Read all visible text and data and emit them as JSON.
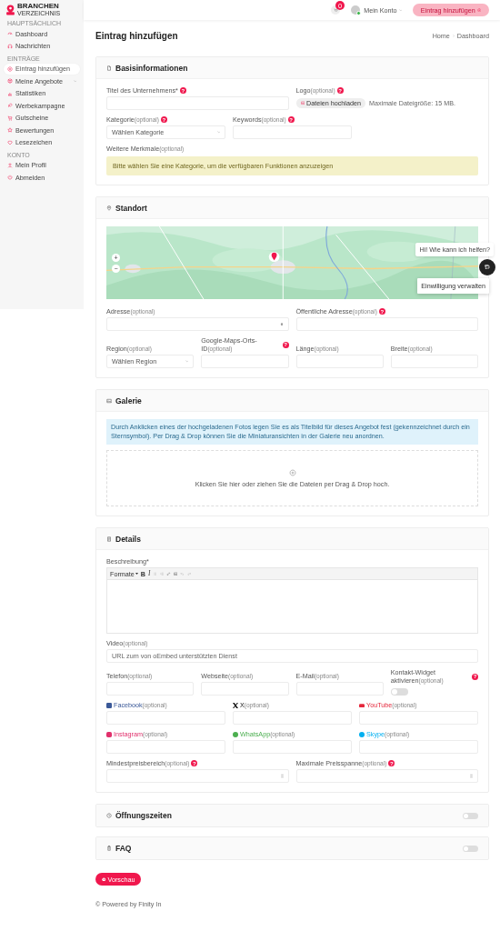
{
  "sidebar": {
    "logo": {
      "line1": "BRANCHEN",
      "line2": "VERZEICHNIS"
    },
    "sections": [
      {
        "heading": "HAUPTSÄCHLICH",
        "items": [
          {
            "label": "Dashboard",
            "selected": false,
            "expandable": false
          },
          {
            "label": "Nachrichten",
            "selected": false,
            "expandable": false
          }
        ]
      },
      {
        "heading": "EINTRÄGE",
        "items": [
          {
            "label": "Eintrag hinzufügen",
            "selected": true,
            "expandable": false
          },
          {
            "label": "Meine Angebote",
            "selected": false,
            "expandable": true
          },
          {
            "label": "Statistiken",
            "selected": false,
            "expandable": false
          },
          {
            "label": "Werbekampagne",
            "selected": false,
            "expandable": false
          },
          {
            "label": "Gutscheine",
            "selected": false,
            "expandable": false
          },
          {
            "label": "Bewertungen",
            "selected": false,
            "expandable": false
          },
          {
            "label": "Lesezeichen",
            "selected": false,
            "expandable": false
          }
        ]
      },
      {
        "heading": "KONTO",
        "items": [
          {
            "label": "Mein Profil",
            "selected": false,
            "expandable": false
          },
          {
            "label": "Abmelden",
            "selected": false,
            "expandable": false
          }
        ]
      }
    ]
  },
  "header": {
    "cart_count": "0",
    "account": "Mein Konto",
    "add_button": "Eintrag hinzufügen"
  },
  "page": {
    "title": "Eintrag hinzufügen",
    "breadcrumb": [
      "Home",
      "Dashboard"
    ]
  },
  "basisinformationen": {
    "title": "Basisinformationen",
    "rows": [
      {
        "fields": [
          {
            "kind": "text",
            "label": "Titel des Unternehmens*",
            "help": "?"
          },
          {
            "kind": "upload",
            "label": "Logo",
            "optional": "(optional)",
            "help": "?",
            "button": "Dateien hochladen",
            "note": "Maximale Dateigröße: 15 MB."
          }
        ]
      },
      {
        "fields": [
          {
            "kind": "select",
            "label": "Kategorie",
            "optional": "(optional)",
            "help": "?",
            "placeholder": "Wählen Kategorie"
          },
          {
            "kind": "text",
            "label": "Keywords",
            "optional": "(optional)",
            "help": "?"
          }
        ]
      },
      {
        "fields": [
          {
            "kind": "notice",
            "label": "Weitere Merkmale",
            "optional": "(optional)",
            "message": "Bitte wählen Sie eine Kategorie, um die verfügbaren Funktionen anzuzeigen"
          }
        ]
      }
    ]
  },
  "standort": {
    "title": "Standort",
    "map": {
      "zoom_in": "+",
      "zoom_out": "−"
    },
    "rows": [
      {
        "fields": [
          {
            "kind": "address",
            "label": "Adresse",
            "optional": "(optional)"
          },
          {
            "kind": "text",
            "label": "Öffentliche Adresse",
            "optional": "(optional)",
            "help": "?"
          }
        ]
      },
      {
        "fields": [
          {
            "kind": "select",
            "label": "Region",
            "optional": "(optional)",
            "placeholder": "Wählen Region"
          },
          {
            "kind": "text",
            "label": "Google-Maps-Orts-ID",
            "optional": "(optional)",
            "help": "?"
          },
          {
            "kind": "text",
            "label": "Länge",
            "optional": "(optional)"
          },
          {
            "kind": "text",
            "label": "Breite",
            "optional": "(optional)"
          }
        ]
      }
    ]
  },
  "galerie": {
    "title": "Galerie",
    "info": "Durch Anklicken eines der hochgeladenen Fotos legen Sie es als Titelbild für dieses Angebot fest (gekennzeichnet durch ein Sternsymbol). Per Drag & Drop können Sie die Miniaturansichten in der Galerie neu anordnen.",
    "dropzone": "Klicken Sie hier oder ziehen Sie die Dateien per Drag & Drop hoch."
  },
  "details": {
    "title": "Details",
    "editor": {
      "label": "Beschreibung*",
      "format": "Formate",
      "bold": "B",
      "italic": "I"
    },
    "rows": [
      {
        "fields": [
          {
            "kind": "text",
            "label": "Video",
            "optional": "(optional)",
            "placeholder": "URL zum von oEmbed unterstützten Dienst"
          }
        ]
      },
      {
        "fields": [
          {
            "kind": "text",
            "label": "Telefon",
            "optional": "(optional)"
          },
          {
            "kind": "text",
            "label": "Webseite",
            "optional": "(optional)"
          },
          {
            "kind": "text",
            "label": "E-Mail",
            "optional": "(optional)"
          },
          {
            "kind": "toggle",
            "label": "Kontakt-Widget aktivieren",
            "optional": "(optional)",
            "help": "?",
            "on": false
          }
        ]
      },
      {
        "fields": [
          {
            "kind": "social",
            "color": "#3b5998",
            "label": "Facebook",
            "optional": "(optional)"
          },
          {
            "kind": "social",
            "color": "#111111",
            "label": "X",
            "optional": "(optional)"
          },
          {
            "kind": "social",
            "color": "#e5283c",
            "label": "YouTube",
            "optional": "(optional)"
          }
        ]
      },
      {
        "fields": [
          {
            "kind": "social",
            "color": "#e1306c",
            "label": "Instagram",
            "optional": "(optional)"
          },
          {
            "kind": "social",
            "color": "#4caf50",
            "label": "WhatsApp",
            "optional": "(optional)"
          },
          {
            "kind": "social",
            "color": "#00aff0",
            "label": "Skype",
            "optional": "(optional)"
          }
        ]
      },
      {
        "fields": [
          {
            "kind": "number",
            "label": "Mindestpreisbereich",
            "optional": "(optional)",
            "help": "?"
          },
          {
            "kind": "number",
            "label": "Maximale Preisspanne",
            "optional": "(optional)",
            "help": "?"
          }
        ]
      }
    ]
  },
  "toggle_sections": [
    {
      "title": "Öffnungszeiten",
      "on": false
    },
    {
      "title": "FAQ",
      "on": false
    }
  ],
  "preview_button": "Vorschau",
  "chat": {
    "greeting": "Hi! Wie kann ich helfen?",
    "consent": "Einwilligung verwalten"
  },
  "footer": "© Powered by Finity In"
}
